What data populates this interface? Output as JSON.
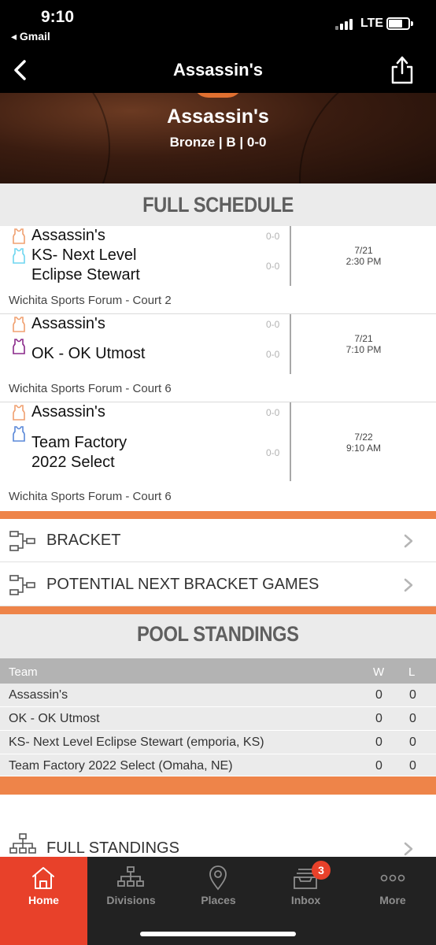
{
  "status_bar": {
    "time": "9:10",
    "back_app": "◂ Gmail",
    "network": "LTE"
  },
  "nav": {
    "title": "Assassin's"
  },
  "hero": {
    "team_name": "Assassin's",
    "subtitle": "Bronze | B | 0-0"
  },
  "schedule": {
    "header": "FULL SCHEDULE",
    "games": [
      {
        "team1": "Assassin's",
        "team1_score": "0-0",
        "team2_lines": [
          "KS- Next Level",
          "Eclipse Stewart"
        ],
        "team2_score": "0-0",
        "date": "7/21",
        "time": "2:30 PM",
        "venue": "Wichita Sports Forum - Court 2"
      },
      {
        "team1": "Assassin's",
        "team1_score": "0-0",
        "team2_lines": [
          "OK - OK Utmost"
        ],
        "team2_score": "0-0",
        "date": "7/21",
        "time": "7:10 PM",
        "venue": "Wichita Sports Forum - Court 6"
      },
      {
        "team1": "Assassin's",
        "team1_score": "0-0",
        "team2_lines": [
          "Team Factory",
          "2022 Select"
        ],
        "team2_score": "0-0",
        "date": "7/22",
        "time": "9:10 AM",
        "venue": "Wichita Sports Forum - Court 6"
      }
    ]
  },
  "links": {
    "bracket": "BRACKET",
    "potential": "POTENTIAL NEXT BRACKET GAMES",
    "full_standings": "FULL STANDINGS"
  },
  "standings": {
    "header": "POOL STANDINGS",
    "columns": {
      "team": "Team",
      "w": "W",
      "l": "L"
    },
    "rows": [
      {
        "team": "Assassin's",
        "w": "0",
        "l": "0"
      },
      {
        "team": "OK - OK Utmost",
        "w": "0",
        "l": "0"
      },
      {
        "team": "KS- Next Level Eclipse Stewart (emporia, KS)",
        "w": "0",
        "l": "0"
      },
      {
        "team": "Team Factory 2022 Select (Omaha, NE)",
        "w": "0",
        "l": "0"
      }
    ]
  },
  "tabs": [
    {
      "label": "Home",
      "icon": "home-icon"
    },
    {
      "label": "Divisions",
      "icon": "divisions-icon"
    },
    {
      "label": "Places",
      "icon": "location-pin-icon"
    },
    {
      "label": "Inbox",
      "icon": "inbox-icon",
      "badge": "3"
    },
    {
      "label": "More",
      "icon": "more-dots-icon"
    }
  ],
  "colors": {
    "accent": "#ee8449",
    "active_tab": "#e8412a",
    "tab_bar": "#222222",
    "team_jersey": "#f0a070",
    "opponent1_jersey": "#6ed6f0",
    "opponent2_jersey": "#8a2a8a",
    "opponent3_jersey": "#5a88d8"
  }
}
